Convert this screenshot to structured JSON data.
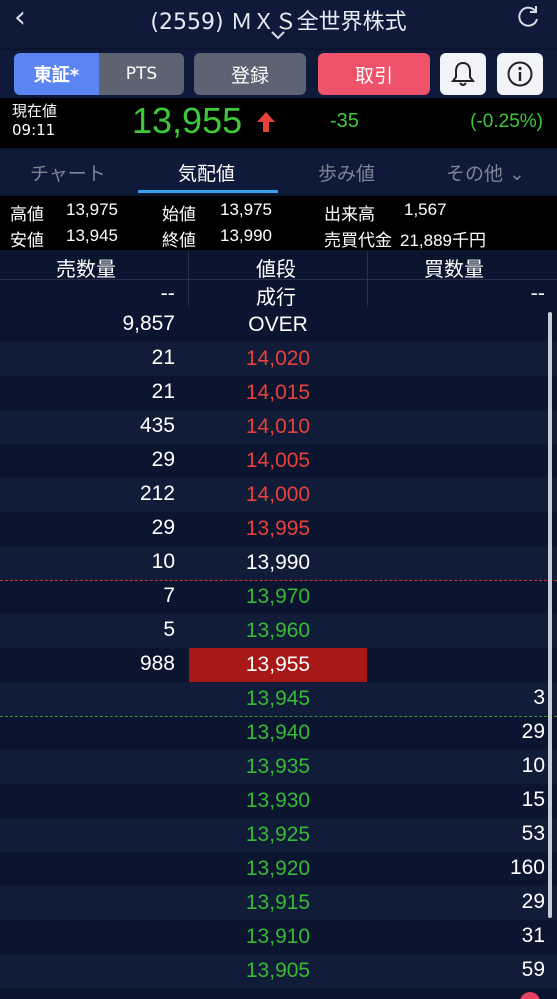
{
  "header": {
    "title": "(2559) ＭＸＳ全世界株式",
    "back_icon": "chevron-left-icon",
    "refresh_icon": "refresh-icon"
  },
  "buttons": {
    "market_primary": "東証*",
    "market_pts": "PTS",
    "register": "登録",
    "trade": "取引"
  },
  "price": {
    "label": "現在値",
    "time": "09:11",
    "value": "13,955",
    "change": "-35",
    "percent": "(-0.25%)",
    "colors": {
      "up": "#e8413a",
      "down": "#36b934"
    }
  },
  "tabs": [
    {
      "label": "チャート"
    },
    {
      "label": "気配値"
    },
    {
      "label": "歩み値"
    },
    {
      "label": "その他 ⌄"
    }
  ],
  "stats": {
    "high_label": "高値",
    "high": "13,975",
    "open_label": "始値",
    "open": "13,975",
    "volume_label": "出来高",
    "volume": "1,567",
    "low_label": "安値",
    "low": "13,945",
    "close_label": "終値",
    "close": "13,990",
    "turnover_label": "売買代金",
    "turnover": "21,889千円"
  },
  "book": {
    "headers": {
      "sell": "売数量",
      "price": "値段",
      "buy": "買数量"
    },
    "market_order": {
      "sell": "--",
      "price": "成行",
      "buy": "--"
    },
    "rows": [
      {
        "sell": "9,857",
        "price": "OVER",
        "buy": ""
      },
      {
        "sell": "21",
        "price": "14,020",
        "buy": ""
      },
      {
        "sell": "21",
        "price": "14,015",
        "buy": ""
      },
      {
        "sell": "435",
        "price": "14,010",
        "buy": ""
      },
      {
        "sell": "29",
        "price": "14,005",
        "buy": ""
      },
      {
        "sell": "212",
        "price": "14,000",
        "buy": ""
      },
      {
        "sell": "29",
        "price": "13,995",
        "buy": ""
      },
      {
        "sell": "10",
        "price": "13,990",
        "buy": ""
      },
      {
        "sell": "7",
        "price": "13,970",
        "buy": ""
      },
      {
        "sell": "5",
        "price": "13,960",
        "buy": ""
      },
      {
        "sell": "988",
        "price": "13,955",
        "buy": ""
      },
      {
        "sell": "",
        "price": "13,945",
        "buy": "3"
      },
      {
        "sell": "",
        "price": "13,940",
        "buy": "29"
      },
      {
        "sell": "",
        "price": "13,935",
        "buy": "10"
      },
      {
        "sell": "",
        "price": "13,930",
        "buy": "15"
      },
      {
        "sell": "",
        "price": "13,925",
        "buy": "53"
      },
      {
        "sell": "",
        "price": "13,920",
        "buy": "160"
      },
      {
        "sell": "",
        "price": "13,915",
        "buy": "29"
      },
      {
        "sell": "",
        "price": "13,910",
        "buy": "31"
      },
      {
        "sell": "",
        "price": "13,905",
        "buy": "59"
      }
    ]
  }
}
